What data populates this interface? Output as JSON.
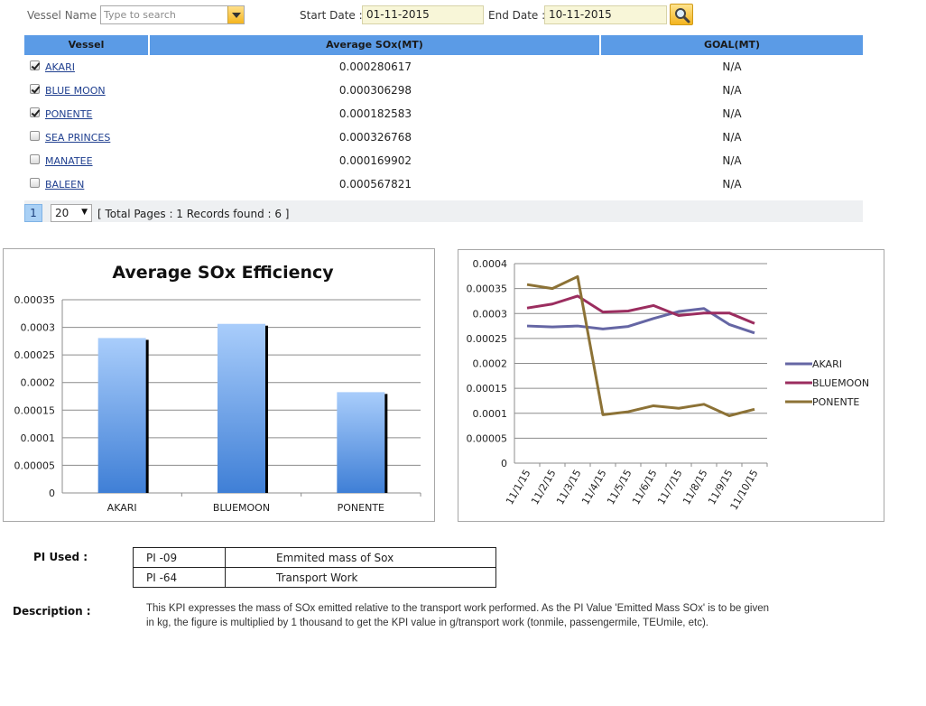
{
  "filters": {
    "vessel_label": "Vessel Name :",
    "vessel_placeholder": "Type to search",
    "start_label": "Start Date :",
    "start_value": "01-11-2015",
    "end_label": "End Date :",
    "end_value": "10-11-2015",
    "search_icon": "search-icon"
  },
  "grid": {
    "headers": [
      "Vessel",
      "Average SOx(MT)",
      "GOAL(MT)"
    ],
    "rows": [
      {
        "vessel": " AKARI",
        "avg": "0.000280617",
        "goal": "N/A",
        "checked": true
      },
      {
        "vessel": "BLUE MOON",
        "avg": "0.000306298",
        "goal": "N/A",
        "checked": true
      },
      {
        "vessel": "PONENTE",
        "avg": "0.000182583",
        "goal": "N/A",
        "checked": true
      },
      {
        "vessel": "SEA PRINCES",
        "avg": "0.000326768",
        "goal": "N/A",
        "checked": false
      },
      {
        "vessel": "MANATEE",
        "avg": "0.000169902",
        "goal": "N/A",
        "checked": false
      },
      {
        "vessel": "BALEEN",
        "avg": "0.000567821",
        "goal": "N/A",
        "checked": false
      }
    ],
    "pager": {
      "current_page": "1",
      "page_size": "20",
      "info": "[ Total Pages : 1  Records found : 6 ]"
    }
  },
  "chart_data": [
    {
      "type": "bar",
      "title": "Average SOx Efficiency",
      "categories": [
        "AKARI",
        "BLUEMOON",
        "PONENTE"
      ],
      "values": [
        0.000280617,
        0.000306298,
        0.000182583
      ],
      "ylim": [
        0,
        0.00035
      ],
      "yticks": [
        "0",
        "0.00005",
        "0.0001",
        "0.00015",
        "0.0002",
        "0.00025",
        "0.0003",
        "0.00035"
      ],
      "grid": true,
      "colors": {
        "bar_top": "#a9cdfb",
        "bar_bottom": "#3f7fd6",
        "shadow": "#000000"
      }
    },
    {
      "type": "line",
      "categories": [
        "11/1/15",
        "11/2/15",
        "11/3/15",
        "11/4/15",
        "11/5/15",
        "11/6/15",
        "11/7/15",
        "11/8/15",
        "11/9/15",
        "11/10/15"
      ],
      "ylim": [
        0,
        0.0004
      ],
      "yticks": [
        "0",
        "0.00005",
        "0.0001",
        "0.00015",
        "0.0002",
        "0.00025",
        "0.0003",
        "0.00035",
        "0.0004"
      ],
      "grid": true,
      "legend_position": "right",
      "series": [
        {
          "name": "AKARI",
          "color": "#6566a4",
          "values": [
            0.000275,
            0.000273,
            0.000275,
            0.000269,
            0.000274,
            0.00029,
            0.000304,
            0.00031,
            0.000278,
            0.000261
          ]
        },
        {
          "name": "BLUEMOON",
          "color": "#9b2d5f",
          "values": [
            0.000311,
            0.000319,
            0.000335,
            0.000303,
            0.000305,
            0.000316,
            0.000296,
            0.000301,
            0.000301,
            0.00028
          ]
        },
        {
          "name": "PONENTE",
          "color": "#8c7236",
          "values": [
            0.000358,
            0.00035,
            0.000374,
            9.7e-05,
            0.000103,
            0.000115,
            0.00011,
            0.000118,
            9.5e-05,
            0.000108
          ]
        }
      ]
    }
  ],
  "pi": {
    "label": "PI Used :",
    "rows": [
      {
        "code": "PI -09",
        "desc": "Emmited mass of Sox"
      },
      {
        "code": "PI -64",
        "desc": "Transport Work"
      }
    ]
  },
  "description": {
    "label": "Description :",
    "text": "This KPI expresses the mass of SOx emitted relative to the transport work performed. As the PI Value 'Emitted Mass SOx' is to be given in kg, the figure is multiplied by 1 thousand to get the KPI value in g/transport work (tonmile, passengermile, TEUmile, etc)."
  }
}
